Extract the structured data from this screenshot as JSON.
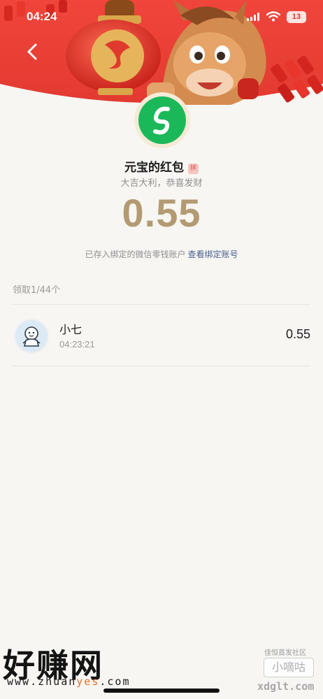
{
  "status_bar": {
    "time": "04:24",
    "battery": "13"
  },
  "header": {
    "back_icon": "chevron-left-icon",
    "logo_icon": "yuanbao-logo-icon"
  },
  "packet": {
    "sender_title": "元宝的红包",
    "pin_badge": "拼",
    "greeting": "大吉大利，恭喜发财",
    "amount": "0.55",
    "deposit_text": "已存入绑定的微信零钱账户",
    "deposit_link": "查看绑定账号"
  },
  "records": {
    "summary": "领取1/44个",
    "items": [
      {
        "name": "小七",
        "time": "04:23:21",
        "amount": "0.55",
        "avatar_icon": "cartoon-avatar-icon"
      }
    ]
  },
  "watermarks": {
    "left_title": "好赚网",
    "left_url_a": "www.zhuan",
    "left_url_b": "yes",
    "left_url_c": ".com",
    "right_small": "佳恒首发社区",
    "right_badge": "小嘀咕",
    "right_url": "xdglt.com"
  },
  "colors": {
    "banner_red": "#ea3c35",
    "amount_gold": "#b39a72",
    "link_blue": "#4b5f8e",
    "logo_green": "#1bb85a",
    "page_bg": "#f7f6f2"
  }
}
